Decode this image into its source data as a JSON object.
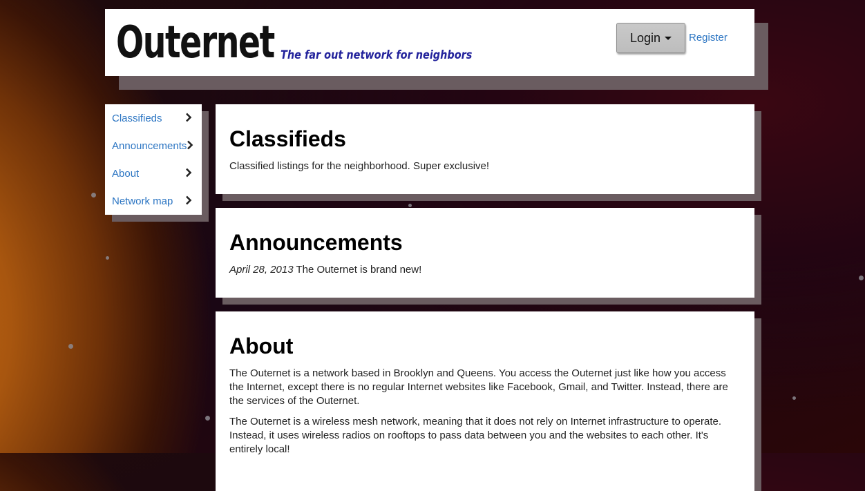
{
  "header": {
    "brand": "Outernet",
    "tagline": "The far out network for neighbors",
    "login_label": "Login",
    "register_label": "Register"
  },
  "sidebar": {
    "items": [
      {
        "label": "Classifieds"
      },
      {
        "label": "Announcements"
      },
      {
        "label": "About"
      },
      {
        "label": "Network map"
      }
    ]
  },
  "sections": {
    "classifieds": {
      "title": "Classifieds",
      "text": "Classified listings for the neighborhood. Super exclusive!"
    },
    "announcements": {
      "title": "Announcements",
      "items": [
        {
          "date": "April 28, 2013",
          "text": "The Outernet is brand new!"
        }
      ]
    },
    "about": {
      "title": "About",
      "paragraphs": [
        "The Outernet is a network based in Brooklyn and Queens. You access the Outernet just like how you access the Internet, except there is no regular Internet websites like Facebook, Gmail, and Twitter. Instead, there are the services of the Outernet.",
        "The Outernet is a wireless mesh network, meaning that it does not rely on Internet infrastructure to operate. Instead, it uses wireless radios on rooftops to pass data between you and the websites to each other. It's entirely local!"
      ]
    }
  },
  "colors": {
    "link": "#2a74c2",
    "tagline": "#23239c",
    "panel_shadow": "#6a5c60"
  }
}
